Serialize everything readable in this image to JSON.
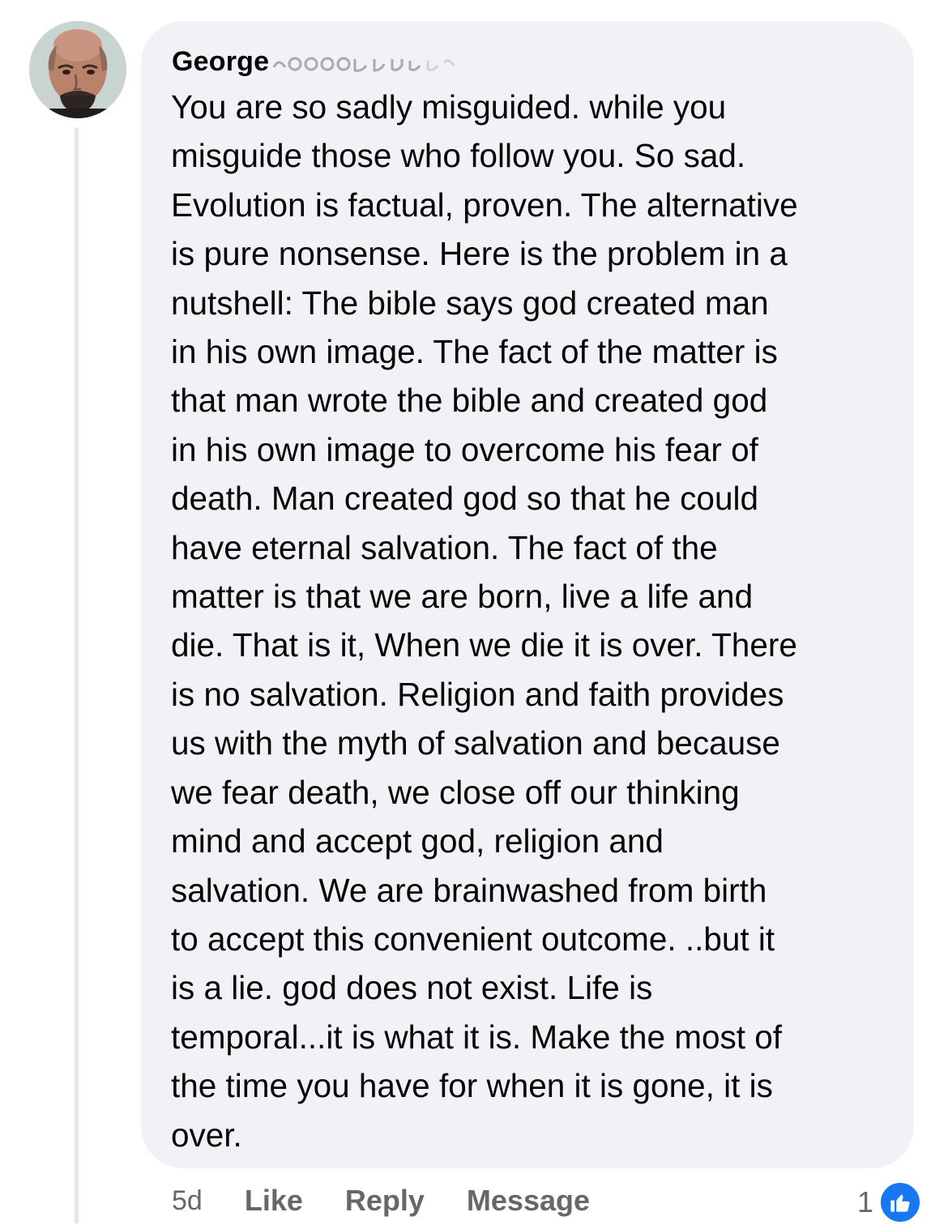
{
  "comment": {
    "author": "George",
    "author_suffix_obscured": true,
    "text_lines": [
      "You are so sadly misguided. while you",
      "misguide those who follow you. So sad.",
      "Evolution is factual, proven. The alternative",
      "is pure nonsense. Here is the problem in a",
      "nutshell: The bible says god created man",
      "in his own image. The fact of the matter is",
      "that man wrote the bible and created god",
      "in his own image to overcome his fear of",
      "death. Man created god so that he could",
      "have eternal salvation. The fact of the",
      "matter is that we are born, live a life and",
      "die. That is it, When we die it is over. There",
      "is no salvation. Religion and faith provides",
      "us with the myth of salvation and because",
      "we fear death, we close off our thinking",
      "mind and accept god, religion and",
      "salvation. We are brainwashed from birth",
      "to accept this convenient outcome. ..but it",
      "is a lie. god does not exist. Life is",
      "temporal...it is what it is. Make the most of",
      "the time you have for when it is gone, it is",
      "over."
    ]
  },
  "actions": {
    "time": "5d",
    "like_label": "Like",
    "reply_label": "Reply",
    "message_label": "Message"
  },
  "reactions": {
    "count": "1",
    "icon": "thumbs-up-icon"
  },
  "colors": {
    "bubble_bg": "#f0f2f5",
    "text": "#050505",
    "secondary_text": "#65676b",
    "like_blue": "#1877f2",
    "thread_line": "#e4e6ea"
  }
}
